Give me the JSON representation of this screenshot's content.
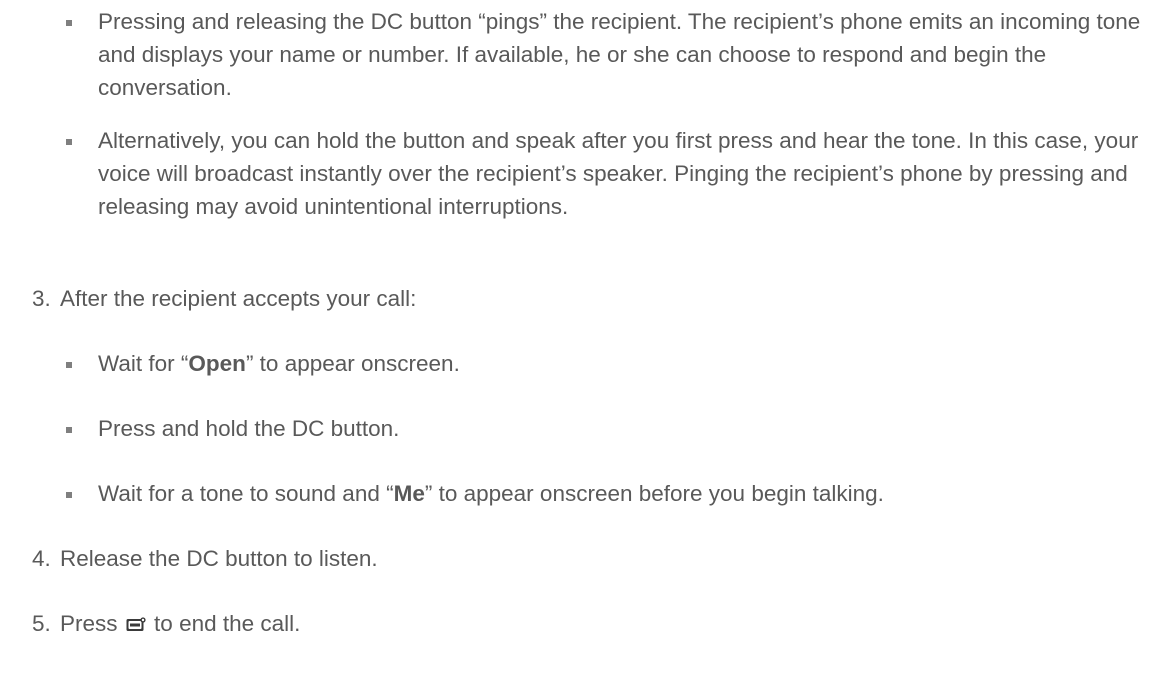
{
  "bullets_top": [
    {
      "text": "Pressing and releasing the DC button “pings” the recipient. The recipient’s phone emits an incoming tone and displays your name or number. If available, he or she can choose to respond and begin the conversation."
    },
    {
      "text": "Alternatively, you can hold the button and speak after you first press and hear the tone. In this case, your voice will broadcast instantly over the recipient’s speaker. Pinging the recipient’s phone by pressing and releasing may avoid unintentional interruptions."
    }
  ],
  "step3": {
    "number": "3.",
    "text": "After the recipient accepts your call:",
    "bullets": [
      {
        "before": "Wait for “",
        "bold": "Open",
        "after": "” to appear onscreen."
      },
      {
        "text": "Press and hold the DC button."
      },
      {
        "before": "Wait for a tone to sound and “",
        "bold": "Me",
        "after": "” to appear onscreen before you begin talking."
      }
    ]
  },
  "step4": {
    "number": "4.",
    "text": "Release the DC button to listen."
  },
  "step5": {
    "number": "5.",
    "before": "Press",
    "icon": "end-call-key-icon",
    "after": "to end the call."
  }
}
